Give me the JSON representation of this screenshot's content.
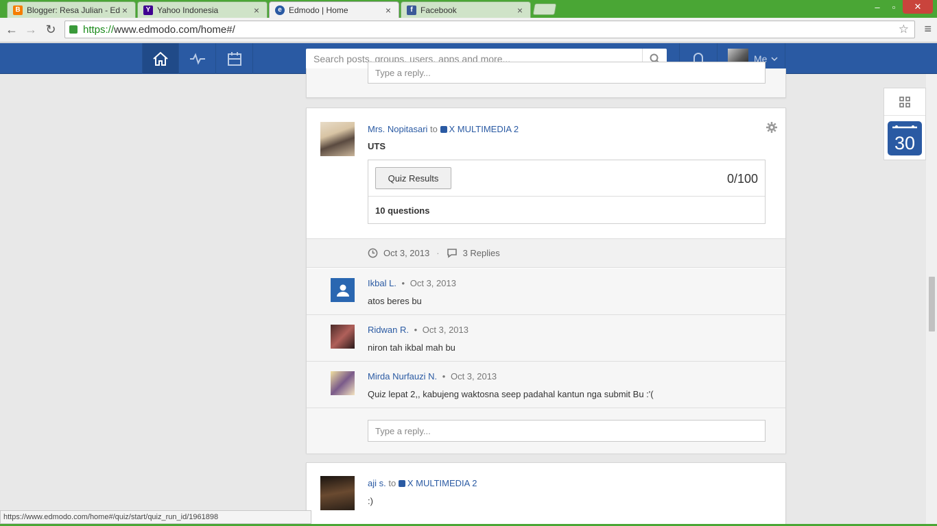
{
  "browser": {
    "tabs": [
      {
        "title": "Blogger: Resa Julian - Edit",
        "favicon": "blogger-icon",
        "color": "#f57d00",
        "active": false
      },
      {
        "title": "Yahoo Indonesia",
        "favicon": "yahoo-icon",
        "color": "#400191",
        "active": false
      },
      {
        "title": "Edmodo | Home",
        "favicon": "edmodo-icon",
        "color": "#2a5aa3",
        "active": true
      },
      {
        "title": "Facebook",
        "favicon": "facebook-icon",
        "color": "#3b5998",
        "active": false
      }
    ],
    "url_scheme": "https://",
    "url_rest": "www.edmodo.com/home#/",
    "status_url": "https://www.edmodo.com/home#/quiz/start/quiz_run_id/1961898"
  },
  "header": {
    "search_placeholder": "Search posts, groups, users, apps and more...",
    "me_label": "Me",
    "brand_color": "#2a5aa3"
  },
  "top_card": {
    "reply_placeholder": "Type a reply..."
  },
  "post": {
    "author": "Mrs. Nopitasari",
    "to": "to",
    "group": "X MULTIMEDIA 2",
    "title": "UTS",
    "quiz": {
      "button_label": "Quiz Results",
      "score": "0/100",
      "questions": "10 questions"
    },
    "date": "Oct 3, 2013",
    "dot": "·",
    "replies_count": "3 Replies",
    "replies": [
      {
        "author": "Ikbal L.",
        "date": "Oct 3, 2013",
        "text": "atos beres bu"
      },
      {
        "author": "Ridwan R.",
        "date": "Oct 3, 2013",
        "text": "niron tah ikbal mah bu"
      },
      {
        "author": "Mirda Nurfauzi N.",
        "date": "Oct 3, 2013",
        "text": "Quiz lepat 2,, kabujeng waktosna seep padahal kantun nga submit Bu :'("
      }
    ],
    "reply_placeholder": "Type a reply..."
  },
  "next_post": {
    "author": "aji s.",
    "to": "to",
    "group": "X MULTIMEDIA 2",
    "text": ":)"
  },
  "side_panel": {
    "calendar_day": "30"
  }
}
